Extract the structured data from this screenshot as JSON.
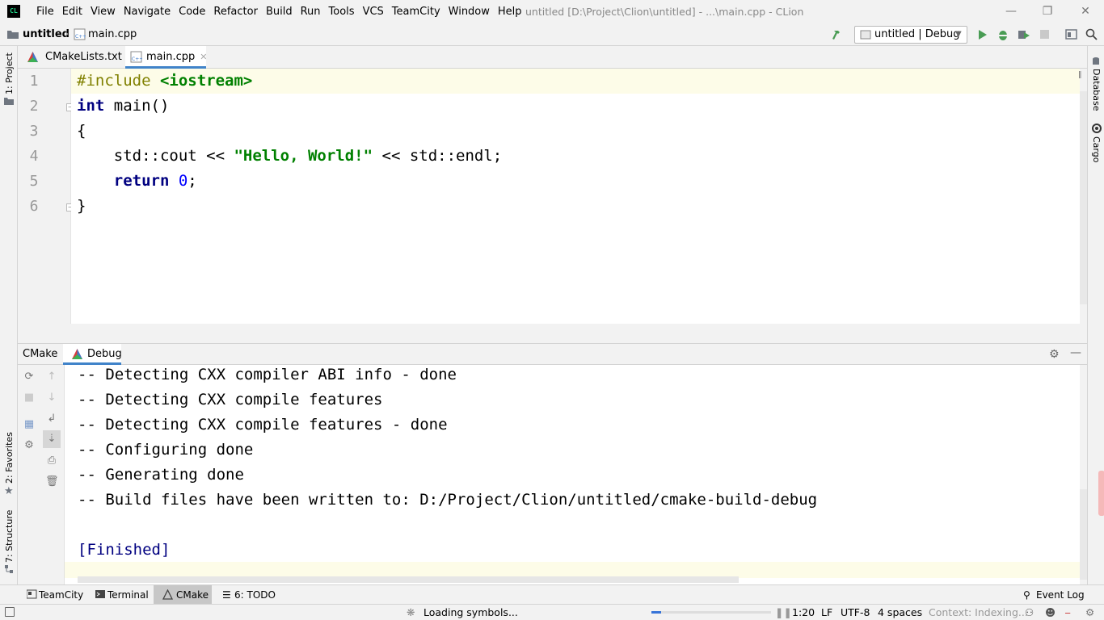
{
  "app": {
    "logo_text": "CL",
    "menu": [
      "File",
      "Edit",
      "View",
      "Navigate",
      "Code",
      "Refactor",
      "Build",
      "Run",
      "Tools",
      "VCS",
      "TeamCity",
      "Window",
      "Help"
    ],
    "window_title": "untitled [D:\\Project\\Clion\\untitled] - ...\\main.cpp - CLion"
  },
  "navbar": {
    "project": "untitled",
    "file": "main.cpp",
    "run_config": "untitled | Debug",
    "icons": [
      "build-hammer-icon",
      "run-icon",
      "debug-icon",
      "run-with-coverage-icon",
      "stop-icon",
      "project-structure-icon",
      "search-everywhere-icon"
    ]
  },
  "left_stripe": {
    "project": "1: Project",
    "favorites": "2: Favorites",
    "structure": "7: Structure"
  },
  "right_stripe": {
    "database": "Database",
    "cargo": "Cargo"
  },
  "editor_tabs": [
    {
      "label": "CMakeLists.txt",
      "icon": "cmake-icon"
    },
    {
      "label": "main.cpp",
      "icon": "cpp-file-icon",
      "active": true
    }
  ],
  "editor": {
    "line_numbers": [
      "1",
      "2",
      "3",
      "4",
      "5",
      "6"
    ],
    "lines": {
      "l1_pp": "#include ",
      "l1_inc": "<iostream>",
      "l2_kw": "int",
      "l2_rest": " main()",
      "l3": "{",
      "l4_a": "    std::cout << ",
      "l4_str": "\"Hello, World!\"",
      "l4_b": " << std::endl;",
      "l5_kw": "    return ",
      "l5_num": "0",
      "l5_rest": ";",
      "l6": "}"
    }
  },
  "tool_window": {
    "tabs": [
      {
        "label": "CMake"
      },
      {
        "label": "Debug",
        "icon": "cmake-icon"
      }
    ],
    "console_lines": [
      "-- Detecting CXX compiler ABI info - done",
      "-- Detecting CXX compile features",
      "-- Detecting CXX compile features - done",
      "-- Configuring done",
      "-- Generating done",
      "-- Build files have been written to: D:/Project/Clion/untitled/cmake-build-debug",
      "",
      "[Finished]"
    ]
  },
  "bottom_tabs": [
    {
      "label": "TeamCity",
      "icon": "teamcity-icon"
    },
    {
      "label": "Terminal",
      "icon": "terminal-icon"
    },
    {
      "label": "CMake",
      "icon": "cmake-icon",
      "active": true
    },
    {
      "label": "6: TODO",
      "icon": "todo-icon"
    }
  ],
  "event_log": "Event Log",
  "status": {
    "task": "Loading symbols...",
    "progress": 0.08,
    "position": "1:20",
    "line_separator": "LF",
    "encoding": "UTF-8",
    "indent": "4 spaces",
    "context": "Context: Indexing..."
  },
  "colors": {
    "keyword": "#000080",
    "string": "#008000",
    "number": "#0000ff",
    "preprocessor": "#808000",
    "accent": "#3874d8"
  }
}
